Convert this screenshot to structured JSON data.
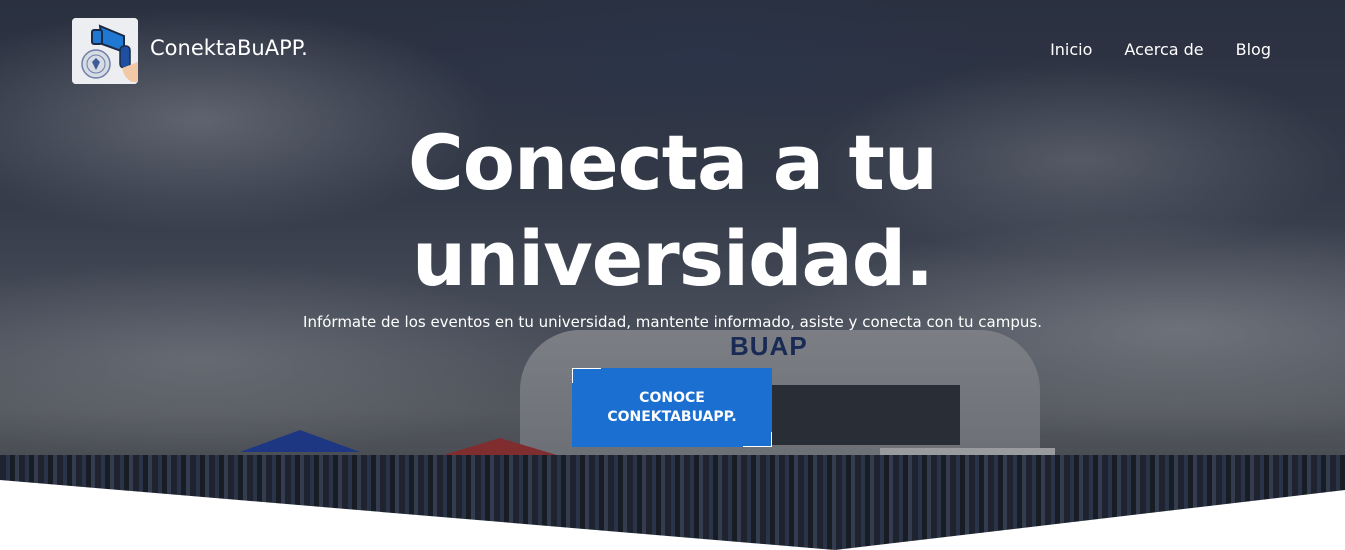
{
  "brand": {
    "logo_icon": "megaphone-seal-icon",
    "name": "ConektaBuAPP."
  },
  "nav": {
    "items": [
      {
        "label": "Inicio"
      },
      {
        "label": "Acerca de"
      },
      {
        "label": "Blog"
      }
    ]
  },
  "hero": {
    "headline_line1": "Conecta a tu",
    "headline_line2": "universidad.",
    "subtitle": "Infórmate de los eventos en tu universidad, mantente informado, asiste y conecta con tu campus.",
    "cta_label": "CONOCE\nCONEKTABUAPP.",
    "background_sign": "BUAP"
  },
  "colors": {
    "cta": "#1a6fd1",
    "text": "#ffffff",
    "curve": "#ffffff"
  }
}
